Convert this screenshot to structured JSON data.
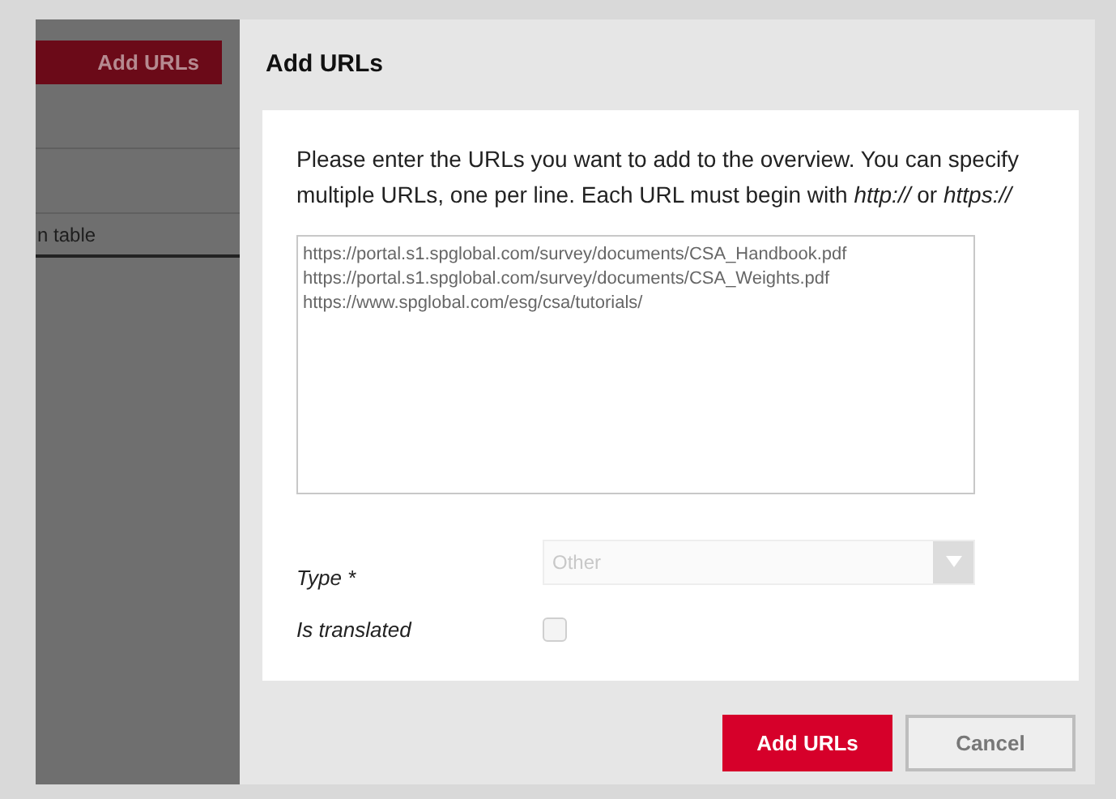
{
  "background_page": {
    "button": "Add URLs",
    "table_label": "n table"
  },
  "dialog": {
    "title": "Add URLs",
    "intro": "Please enter the URLs you want to add to the overview. You can specify multiple URLs, one per line. Each URL must begin with *http://* or *https://*",
    "urls": "https://portal.s1.spglobal.com/survey/documents/CSA_Handbook.pdf\nhttps://portal.s1.spglobal.com/survey/documents/CSA_Weights.pdf\nhttps://www.spglobal.com/esg/csa/tutorials/",
    "type": {
      "label": "Type *",
      "value": "Other",
      "disabled": true
    },
    "is_translated": {
      "label": "Is translated",
      "checked": false
    },
    "buttons": [
      {
        "label": "Add URLs",
        "kind": "primary"
      },
      {
        "label": "Cancel",
        "kind": "secondary"
      }
    ]
  }
}
